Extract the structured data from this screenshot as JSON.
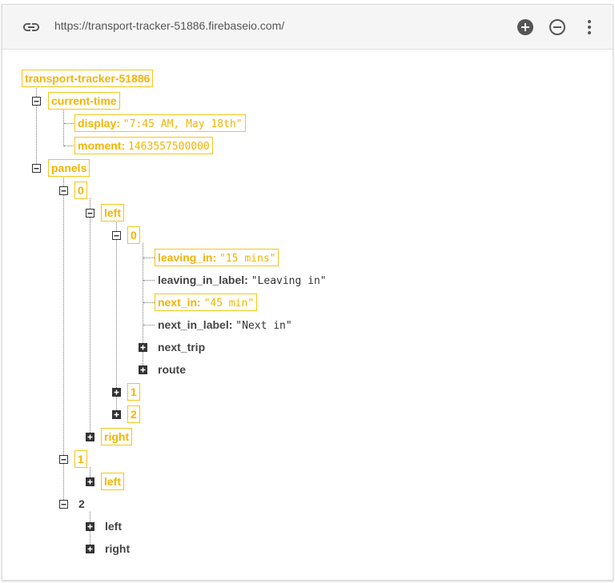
{
  "toolbar": {
    "url": "https://transport-tracker-51886.firebaseio.com/",
    "link_icon": "link-icon",
    "add_icon": "add-circle-icon",
    "remove_icon": "remove-circle-icon",
    "more_icon": "more-vert-icon"
  },
  "tree": {
    "root": "transport-tracker-51886",
    "current_time": "current-time",
    "display_key": "display:",
    "display_val": "\"7:45 AM, May 18th\"",
    "moment_key": "moment:",
    "moment_val": "1463557500000",
    "panels": "panels",
    "p0": "0",
    "p0_left": "left",
    "p0_left_0": "0",
    "leaving_in_key": "leaving_in:",
    "leaving_in_val": "\"15 mins\"",
    "leaving_in_label_key": "leaving_in_label:",
    "leaving_in_label_val": "\"Leaving in\"",
    "next_in_key": "next_in:",
    "next_in_val": "\"45 min\"",
    "next_in_label_key": "next_in_label:",
    "next_in_label_val": "\"Next in\"",
    "next_trip": "next_trip",
    "route": "route",
    "p0_left_1": "1",
    "p0_left_2": "2",
    "p0_right": "right",
    "p1": "1",
    "p1_left": "left",
    "p2": "2",
    "p2_left": "left",
    "p2_right": "right"
  },
  "colors": {
    "highlight": "#f5b400",
    "text": "#444444"
  }
}
